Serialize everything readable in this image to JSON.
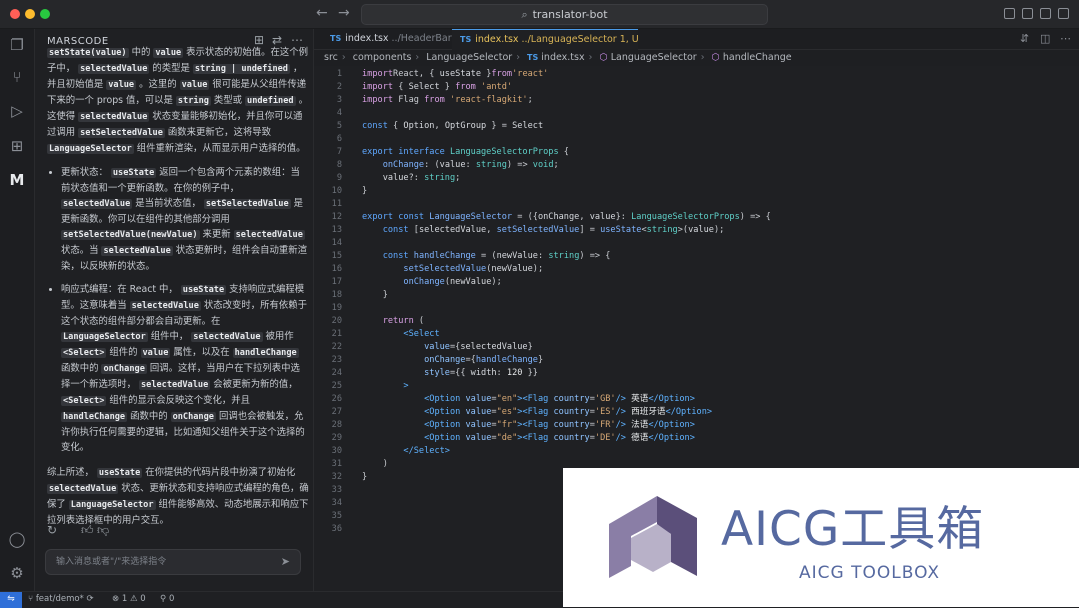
{
  "window": {
    "title": "translator-bot"
  },
  "sidebar": {
    "title": "MARSCODE"
  },
  "chat": {
    "intro": [
      {
        "t": "setState(value)",
        "c": true
      },
      {
        "t": " 中的 "
      },
      {
        "t": "value",
        "c": true
      },
      {
        "t": " 表示状态的初始值。在这个例子中， "
      },
      {
        "t": "selectedValue",
        "c": true
      },
      {
        "t": " 的类型是 "
      },
      {
        "t": "string | undefined",
        "c": true
      },
      {
        "t": " ，并且初始值是 "
      },
      {
        "t": "value",
        "c": true
      },
      {
        "t": " 。这里的 "
      },
      {
        "t": "value",
        "c": true
      },
      {
        "t": " 很可能是从父组件传递下来的一个 props 值，可以是 "
      },
      {
        "t": "string",
        "c": true
      },
      {
        "t": " 类型或 "
      },
      {
        "t": "undefined",
        "c": true
      },
      {
        "t": " 。这使得 "
      },
      {
        "t": "selectedValue",
        "c": true
      },
      {
        "t": " 状态变量能够初始化，并且你可以通过调用 "
      },
      {
        "t": "setSelectedValue",
        "c": true
      },
      {
        "t": " 函数来更新它，这将导致 "
      },
      {
        "t": "LanguageSelector",
        "c": true
      },
      {
        "t": " 组件重新渲染，从而显示用户选择的值。"
      }
    ],
    "bullets": [
      [
        {
          "t": "更新状态： "
        },
        {
          "t": "useState",
          "c": true
        },
        {
          "t": " 返回一个包含两个元素的数组：当前状态值和一个更新函数。在你的例子中， "
        },
        {
          "t": "selectedValue",
          "c": true
        },
        {
          "t": " 是当前状态值， "
        },
        {
          "t": "setSelectedValue",
          "c": true
        },
        {
          "t": " 是更新函数。你可以在组件的其他部分调用 "
        },
        {
          "t": "setSelectedValue(newValue)",
          "c": true
        },
        {
          "t": " 来更新 "
        },
        {
          "t": "selectedValue",
          "c": true
        },
        {
          "t": " 状态。当 "
        },
        {
          "t": "selectedValue",
          "c": true
        },
        {
          "t": " 状态更新时，组件会自动重新渲染，以反映新的状态。"
        }
      ],
      [
        {
          "t": "响应式编程：在 React 中， "
        },
        {
          "t": "useState",
          "c": true
        },
        {
          "t": " 支持响应式编程模型。这意味着当 "
        },
        {
          "t": "selectedValue",
          "c": true
        },
        {
          "t": " 状态改变时，所有依赖于这个状态的组件部分都会自动更新。在 "
        },
        {
          "t": "LanguageSelector",
          "c": true
        },
        {
          "t": " 组件中， "
        },
        {
          "t": "selectedValue",
          "c": true
        },
        {
          "t": " 被用作 "
        },
        {
          "t": "<Select>",
          "c": true
        },
        {
          "t": " 组件的 "
        },
        {
          "t": "value",
          "c": true
        },
        {
          "t": " 属性，以及在 "
        },
        {
          "t": "handleChange",
          "c": true
        },
        {
          "t": " 函数中的 "
        },
        {
          "t": "onChange",
          "c": true
        },
        {
          "t": " 回调。这样，当用户在下拉列表中选择一个新选项时， "
        },
        {
          "t": "selectedValue",
          "c": true
        },
        {
          "t": " 会被更新为新的值， "
        },
        {
          "t": "<Select>",
          "c": true
        },
        {
          "t": " 组件的显示会反映这个变化，并且 "
        },
        {
          "t": "handleChange",
          "c": true
        },
        {
          "t": " 函数中的 "
        },
        {
          "t": "onChange",
          "c": true
        },
        {
          "t": " 回调也会被触发，允许你执行任何需要的逻辑，比如通知父组件关于这个选择的变化。"
        }
      ]
    ],
    "summary": [
      {
        "t": "综上所述， "
      },
      {
        "t": "useState",
        "c": true
      },
      {
        "t": " 在你提供的代码片段中扮演了初始化 "
      },
      {
        "t": "selectedValue",
        "c": true
      },
      {
        "t": " 状态、更新状态和支持响应式编程的角色，确保了 "
      },
      {
        "t": "LanguageSelector",
        "c": true
      },
      {
        "t": " 组件能够高效、动态地展示和响应下拉列表选择框中的用户交互。"
      }
    ],
    "input_placeholder": "输入消息或者\"/\"来选择指令"
  },
  "tabs": [
    {
      "name": "index.tsx",
      "path": "../HeaderBar",
      "active": false,
      "ts_label": "TS"
    },
    {
      "name": "index.tsx",
      "path": "../LanguageSelector 1, U",
      "active": true,
      "ts_label": "TS"
    }
  ],
  "breadcrumb": [
    "src",
    "components",
    "LanguageSelector",
    "index.tsx",
    "LanguageSelector",
    "handleChange"
  ],
  "code_lines": [
    [
      [
        "kw",
        "import"
      ],
      [
        "",
        "React, { "
      ],
      [
        "var",
        "useState"
      ],
      [
        "",
        " }"
      ],
      [
        "kw",
        "from"
      ],
      [
        "str",
        "'react'"
      ]
    ],
    [
      [
        "kw",
        "import"
      ],
      [
        "",
        " { "
      ],
      [
        "var",
        "Select"
      ],
      [
        "",
        " } "
      ],
      [
        "kw",
        "from"
      ],
      [
        "str",
        " 'antd'"
      ]
    ],
    [
      [
        "kw",
        "import"
      ],
      [
        "",
        " Flag "
      ],
      [
        "kw",
        "from"
      ],
      [
        "str",
        " 'react-flagkit'"
      ],
      [
        "",
        ";"
      ]
    ],
    [],
    [
      [
        "kw2",
        "const"
      ],
      [
        "",
        " { "
      ],
      [
        "var",
        "Option"
      ],
      [
        "",
        ", "
      ],
      [
        "var",
        "OptGroup"
      ],
      [
        "",
        " } = "
      ],
      [
        "var",
        "Select"
      ]
    ],
    [],
    [
      [
        "kw2",
        "export interface "
      ],
      [
        "ty",
        "LanguageSelectorProps"
      ],
      [
        "",
        " {"
      ]
    ],
    [
      [
        "",
        "    "
      ],
      [
        "fn",
        "onChange"
      ],
      [
        "",
        ": ("
      ],
      [
        "var",
        "value"
      ],
      [
        "",
        ": "
      ],
      [
        "ty",
        "string"
      ],
      [
        "",
        ") => "
      ],
      [
        "ty",
        "void"
      ],
      [
        "",
        ";"
      ]
    ],
    [
      [
        "",
        "    "
      ],
      [
        "var",
        "value"
      ],
      [
        "",
        "?: "
      ],
      [
        "ty",
        "string"
      ],
      [
        "",
        ";"
      ]
    ],
    [
      [
        "",
        "}"
      ]
    ],
    [],
    [
      [
        "kw2",
        "export const "
      ],
      [
        "fn",
        "LanguageSelector"
      ],
      [
        "",
        " = ({"
      ],
      [
        "var",
        "onChange"
      ],
      [
        "",
        ", "
      ],
      [
        "var",
        "value"
      ],
      [
        "",
        "}: "
      ],
      [
        "ty",
        "LanguageSelectorProps"
      ],
      [
        "",
        ") => {"
      ]
    ],
    [
      [
        "",
        "    "
      ],
      [
        "kw2",
        "const"
      ],
      [
        "",
        " ["
      ],
      [
        "var",
        "selectedValue"
      ],
      [
        "",
        ", "
      ],
      [
        "fn",
        "setSelectedValue"
      ],
      [
        "",
        "] = "
      ],
      [
        "fn",
        "useState"
      ],
      [
        "",
        "<"
      ],
      [
        "ty",
        "string"
      ],
      [
        "",
        ">("
      ],
      [
        "var",
        "value"
      ],
      [
        "",
        ");"
      ]
    ],
    [],
    [
      [
        "",
        "    "
      ],
      [
        "kw2",
        "const"
      ],
      [
        "",
        " "
      ],
      [
        "fn",
        "handleChange"
      ],
      [
        "",
        " = ("
      ],
      [
        "var",
        "newValue"
      ],
      [
        "",
        ": "
      ],
      [
        "ty",
        "string"
      ],
      [
        "",
        ") => {"
      ]
    ],
    [
      [
        "",
        "        "
      ],
      [
        "fn",
        "setSelectedValue"
      ],
      [
        "",
        "("
      ],
      [
        "var",
        "newValue"
      ],
      [
        "",
        ");"
      ]
    ],
    [
      [
        "",
        "        "
      ],
      [
        "fn",
        "onChange"
      ],
      [
        "",
        "("
      ],
      [
        "var",
        "newValue"
      ],
      [
        "",
        ");"
      ]
    ],
    [
      [
        "",
        "    }"
      ]
    ],
    [],
    [
      [
        "",
        "    "
      ],
      [
        "kw",
        "return"
      ],
      [
        "",
        " ("
      ]
    ],
    [
      [
        "",
        "        "
      ],
      [
        "tag",
        "<Select"
      ]
    ],
    [
      [
        "",
        "            "
      ],
      [
        "attr",
        "value"
      ],
      [
        "",
        "={"
      ],
      [
        "var",
        "selectedValue"
      ],
      [
        "",
        "}"
      ]
    ],
    [
      [
        "",
        "            "
      ],
      [
        "attr",
        "onChange"
      ],
      [
        "",
        "={"
      ],
      [
        "fn",
        "handleChange"
      ],
      [
        "",
        "}"
      ]
    ],
    [
      [
        "",
        "            "
      ],
      [
        "attr",
        "style"
      ],
      [
        "",
        "={{ "
      ],
      [
        "var",
        "width"
      ],
      [
        "",
        ": "
      ],
      [
        "cn",
        "120"
      ],
      [
        "",
        " }}"
      ]
    ],
    [
      [
        "",
        "        "
      ],
      [
        "tag",
        ">"
      ]
    ],
    [
      [
        "",
        "            "
      ],
      [
        "tag",
        "<Option "
      ],
      [
        "attr",
        "value"
      ],
      [
        "",
        "="
      ],
      [
        "str",
        "\"en\""
      ],
      [
        "tag",
        "><Flag "
      ],
      [
        "attr",
        "country"
      ],
      [
        "",
        "="
      ],
      [
        "str",
        "'GB'"
      ],
      [
        "tag",
        "/>"
      ],
      [
        "cn",
        " 英语"
      ],
      [
        "tag",
        "</Option>"
      ]
    ],
    [
      [
        "",
        "            "
      ],
      [
        "tag",
        "<Option "
      ],
      [
        "attr",
        "value"
      ],
      [
        "",
        "="
      ],
      [
        "str",
        "\"es\""
      ],
      [
        "tag",
        "><Flag "
      ],
      [
        "attr",
        "country"
      ],
      [
        "",
        "="
      ],
      [
        "str",
        "'ES'"
      ],
      [
        "tag",
        "/>"
      ],
      [
        "cn",
        " 西班牙语"
      ],
      [
        "tag",
        "</Option>"
      ]
    ],
    [
      [
        "",
        "            "
      ],
      [
        "tag",
        "<Option "
      ],
      [
        "attr",
        "value"
      ],
      [
        "",
        "="
      ],
      [
        "str",
        "\"fr\""
      ],
      [
        "tag",
        "><Flag "
      ],
      [
        "attr",
        "country"
      ],
      [
        "",
        "="
      ],
      [
        "str",
        "'FR'"
      ],
      [
        "tag",
        "/>"
      ],
      [
        "cn",
        " 法语"
      ],
      [
        "tag",
        "</Option>"
      ]
    ],
    [
      [
        "",
        "            "
      ],
      [
        "tag",
        "<Option "
      ],
      [
        "attr",
        "value"
      ],
      [
        "",
        "="
      ],
      [
        "str",
        "\"de\""
      ],
      [
        "tag",
        "><Flag "
      ],
      [
        "attr",
        "country"
      ],
      [
        "",
        "="
      ],
      [
        "str",
        "'DE'"
      ],
      [
        "tag",
        "/>"
      ],
      [
        "cn",
        " 德语"
      ],
      [
        "tag",
        "</Option>"
      ]
    ],
    [
      [
        "",
        "        "
      ],
      [
        "tag",
        "</Select>"
      ]
    ],
    [
      [
        "",
        "    )"
      ]
    ],
    [
      [
        "",
        "}"
      ]
    ],
    [],
    [],
    [],
    []
  ],
  "status": {
    "branch": "feat/demo*",
    "errors": "1",
    "warnings": "0",
    "ports": "0"
  },
  "watermark": {
    "title": "AICG工具箱",
    "subtitle": "AICG TOOLBOX"
  }
}
